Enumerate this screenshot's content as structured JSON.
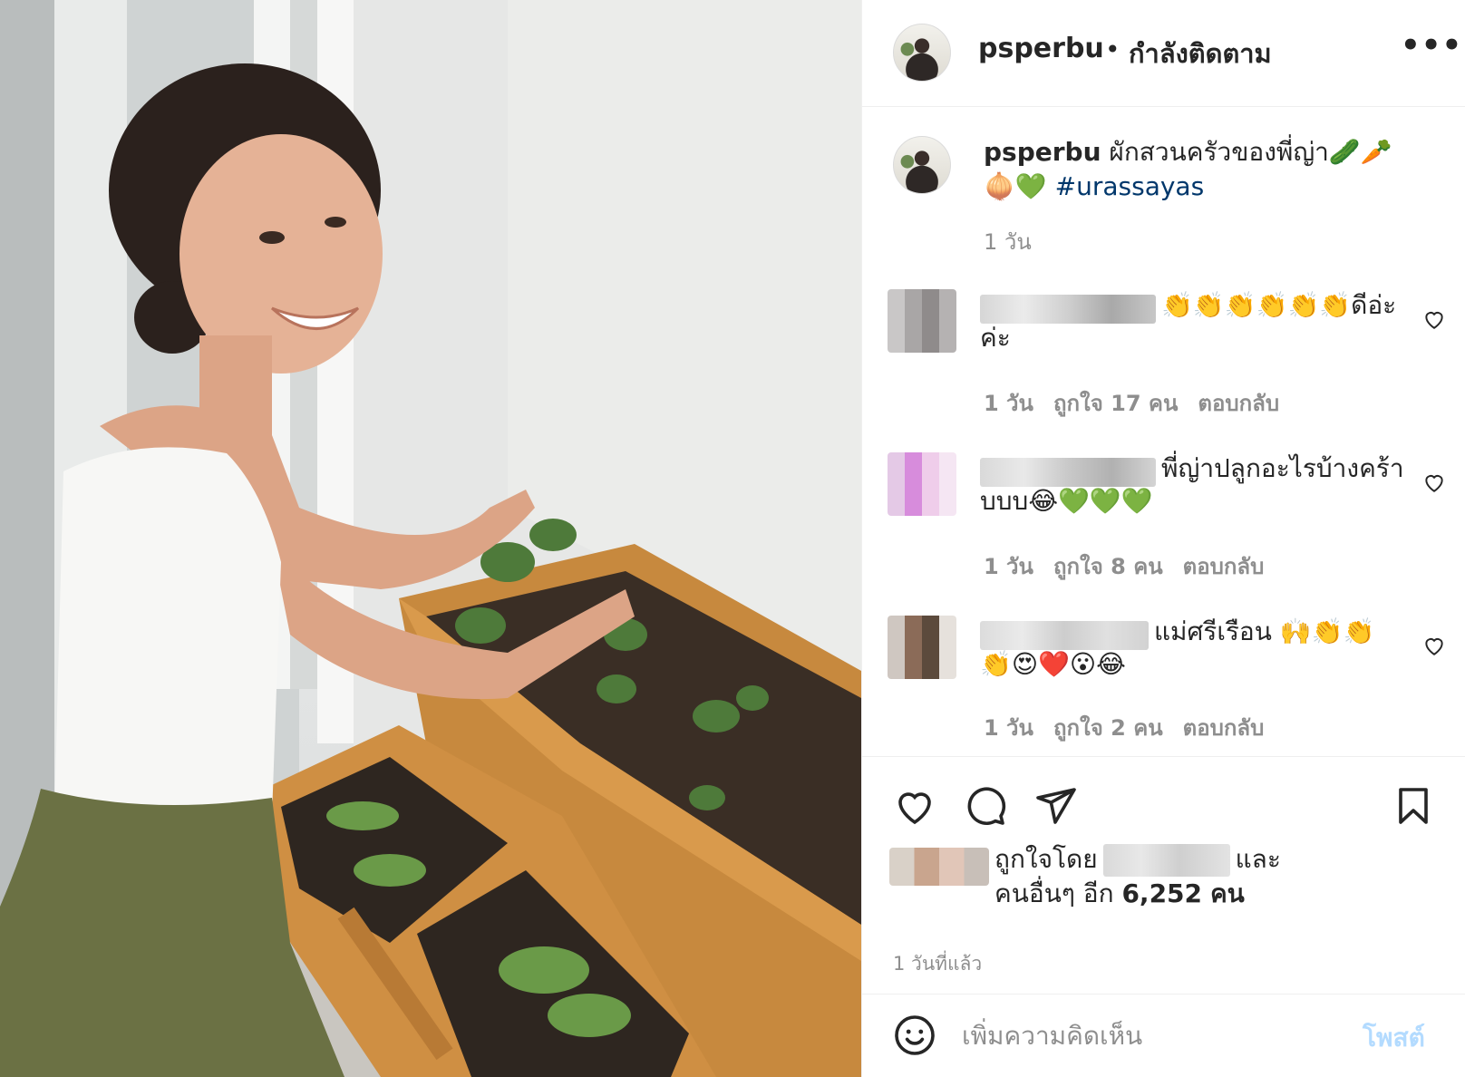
{
  "photo": {
    "alt_icon": "photo"
  },
  "header": {
    "username": "psperbu",
    "separator": "•",
    "follow_status": "กำลังติดตาม",
    "more_icon": "more-horizontal-icon",
    "more_label": "•••"
  },
  "caption": {
    "username": "psperbu",
    "text": " ผักสวนครัวของพี่ญ่า🥒🥕 🧅💚 ",
    "hashtag": "#urassayas",
    "time": "1 วัน"
  },
  "comments": [
    {
      "text": "👏👏👏👏👏👏ดีอ่ะค่ะ",
      "time": "1 วัน",
      "likes": "ถูกใจ 17 คน",
      "reply": "ตอบกลับ"
    },
    {
      "text": "พี่ญ่าปลูกอะไรบ้างคร้าบบบ😂💚💚💚",
      "time": "1 วัน",
      "likes": "ถูกใจ 8 คน",
      "reply": "ตอบกลับ"
    },
    {
      "text": "แม่ศรีเรือน 🙌👏👏👏😍❤️😮😂",
      "time": "1 วัน",
      "likes": "ถูกใจ 2 คน",
      "reply": "ตอบกลับ"
    }
  ],
  "actions": {
    "like_icon": "heart-icon",
    "comment_icon": "comment-icon",
    "share_icon": "paper-plane-icon",
    "save_icon": "bookmark-icon"
  },
  "likes": {
    "prefix": "ถูกใจโดย",
    "connector": "และ",
    "others_prefix": "คนอื่นๆ อีก",
    "count": "6,252",
    "suffix": "คน"
  },
  "post_time": "1 วันที่แล้ว",
  "add_comment": {
    "placeholder": "เพิ่มความคิดเห็น",
    "post_label": "โพสต์",
    "emoji_icon": "smile-icon"
  }
}
